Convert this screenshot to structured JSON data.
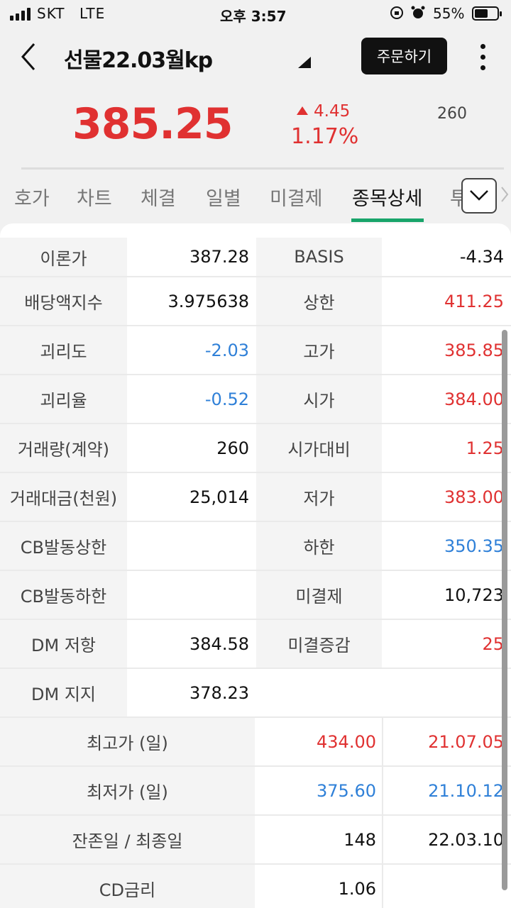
{
  "status_bar": {
    "carrier": "SKT",
    "network": "LTE",
    "time": "오후 3:57",
    "battery": "55%",
    "battery_level": 0.55
  },
  "header": {
    "title": "선물22.03월kp",
    "order_button": "주문하기"
  },
  "summary": {
    "price": "385.25",
    "change": "4.45",
    "change_pct": "1.17%",
    "volume": "260"
  },
  "tabs": [
    "호가",
    "차트",
    "체결",
    "일별",
    "미결제",
    "종목상세",
    "투"
  ],
  "active_tab": "종목상세",
  "rows": [
    {
      "l1": "이론가",
      "v1": "387.28",
      "l2": "BASIS",
      "v2": "-4.34"
    },
    {
      "l1": "배당액지수",
      "v1": "3.975638",
      "l2": "상한",
      "v2": "411.25"
    },
    {
      "l1": "괴리도",
      "v1": "-2.03",
      "l2": "고가",
      "v2": "385.85"
    },
    {
      "l1": "괴리율",
      "v1": "-0.52",
      "l2": "시가",
      "v2": "384.00"
    },
    {
      "l1": "거래량(계약)",
      "v1": "260",
      "l2": "시가대비",
      "v2": "1.25"
    },
    {
      "l1": "거래대금(천원)",
      "v1": "25,014",
      "l2": "저가",
      "v2": "383.00"
    },
    {
      "l1": "CB발동상한",
      "v1": "",
      "l2": "하한",
      "v2": "350.35"
    },
    {
      "l1": "CB발동하한",
      "v1": "",
      "l2": "미결제",
      "v2": "10,723"
    },
    {
      "l1": "DM 저항",
      "v1": "384.58",
      "l2": "미결증감",
      "v2": "25"
    },
    {
      "l1": "DM 지지",
      "v1": "378.23",
      "l2": "",
      "v2": ""
    }
  ],
  "wide_rows": [
    {
      "label": "최고가 (일)",
      "v1": "434.00",
      "v2": "21.07.05"
    },
    {
      "label": "최저가 (일)",
      "v1": "375.60",
      "v2": "21.10.12"
    },
    {
      "label": "잔존일 / 최종일",
      "v1": "148",
      "v2": "22.03.10"
    },
    {
      "label": "CD금리",
      "v1": "1.06",
      "v2": ""
    }
  ],
  "colors": {
    "up": "#e03131",
    "down": "#2f80d8",
    "tab_accent": "#18a46a"
  }
}
